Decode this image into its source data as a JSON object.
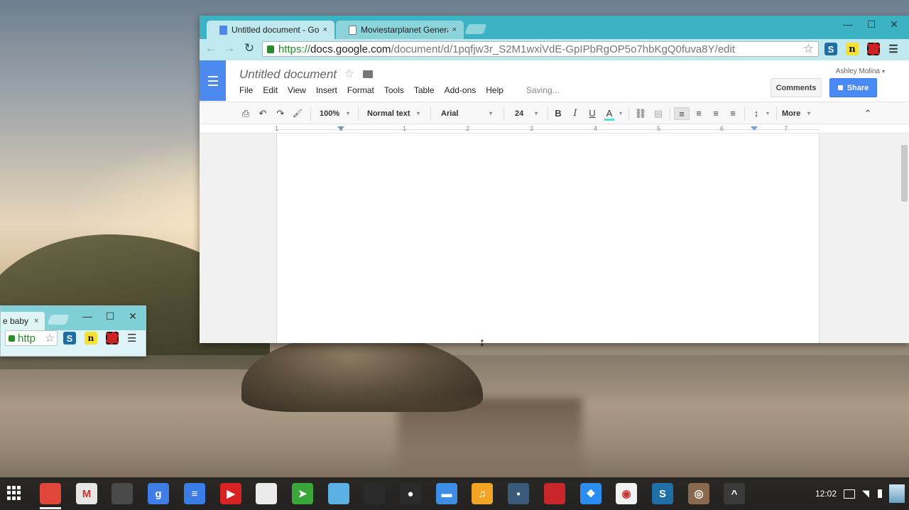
{
  "background_window": {
    "tab_title": "e baby",
    "close_glyph": "×",
    "controls": {
      "minimize": "—",
      "maximize": "☐",
      "close": "✕"
    },
    "url_text": "http",
    "star_glyph": "☆",
    "extensions": {
      "s": "S",
      "n": "n"
    },
    "menu_glyph": "☰"
  },
  "browser": {
    "tabs": [
      {
        "title": "Untitled document - Goo",
        "close": "×",
        "favicon": "docs-icon"
      },
      {
        "title": "Moviestarplanet Genera",
        "close": "×",
        "favicon": "page-icon"
      }
    ],
    "window_controls": {
      "minimize": "—",
      "maximize": "☐",
      "close": "✕"
    },
    "nav": {
      "back": "←",
      "forward": "→",
      "reload": "↻"
    },
    "url": {
      "scheme": "https://",
      "host": "docs.google.com",
      "path": "/document/d/1pqfjw3r_S2M1wxiVdE-GpIPbRgOP5o7hbKgQ0fuva8Y/edit"
    },
    "star": "☆",
    "extensions": {
      "s": "S",
      "n": "n"
    },
    "menu": "☰"
  },
  "docs": {
    "title": "Untitled document",
    "star": "☆",
    "menu": [
      "File",
      "Edit",
      "View",
      "Insert",
      "Format",
      "Tools",
      "Table",
      "Add-ons",
      "Help"
    ],
    "status": "Saving...",
    "user": "Ashley Molina",
    "user_caret": "▾",
    "comments_label": "Comments",
    "share_label": "Share",
    "toolbar": {
      "print": "⎙",
      "undo": "↶",
      "redo": "↷",
      "paint_format": "🖌",
      "zoom": "100%",
      "style": "Normal text",
      "font": "Arial",
      "size": "24",
      "bold": "B",
      "italic": "I",
      "underline": "U",
      "text_color": "A",
      "link": "⛓",
      "comment": "▤",
      "align_left": "≡",
      "align_center": "≡",
      "align_right": "≡",
      "justify": "≡",
      "line_spacing": "↕",
      "more": "More",
      "collapse": "⌃",
      "caret": "▾"
    },
    "ruler_numbers": [
      "1",
      "1",
      "1",
      "2",
      "3",
      "4",
      "5",
      "6",
      "7"
    ]
  },
  "shelf": {
    "apps": [
      {
        "name": "chrome",
        "color": "#e0463a",
        "glyph": ""
      },
      {
        "name": "gmail",
        "color": "#e6e6e6",
        "glyph": "M"
      },
      {
        "name": "web-store",
        "color": "#4a4a4a",
        "glyph": ""
      },
      {
        "name": "google-search",
        "color": "#3f7ee8",
        "glyph": "g"
      },
      {
        "name": "docs",
        "color": "#3a7de6",
        "glyph": "≡"
      },
      {
        "name": "youtube",
        "color": "#d92323",
        "glyph": "▶"
      },
      {
        "name": "paint",
        "color": "#ececec",
        "glyph": ""
      },
      {
        "name": "send",
        "color": "#3aa63a",
        "glyph": "➤"
      },
      {
        "name": "files-drive",
        "color": "#5bb1e3",
        "glyph": ""
      },
      {
        "name": "crackle",
        "color": "#2b2b2b",
        "glyph": ""
      },
      {
        "name": "camera",
        "color": "#2a2a2a",
        "glyph": "●"
      },
      {
        "name": "files",
        "color": "#3e8de5",
        "glyph": "▬"
      },
      {
        "name": "music",
        "color": "#f2a524",
        "glyph": "♫"
      },
      {
        "name": "blocks",
        "color": "#3a5a7a",
        "glyph": "▪"
      },
      {
        "name": "red-app",
        "color": "#c9262c",
        "glyph": ""
      },
      {
        "name": "books",
        "color": "#2b8df2",
        "glyph": "❖"
      },
      {
        "name": "photo",
        "color": "#f2f2f2",
        "glyph": "◉"
      },
      {
        "name": "s-app",
        "color": "#1f6fa6",
        "glyph": "S"
      },
      {
        "name": "instagram",
        "color": "#8a6a4e",
        "glyph": "◎"
      },
      {
        "name": "more-apps",
        "color": "#3a3a3a",
        "glyph": "^"
      }
    ],
    "clock": "12:02"
  }
}
